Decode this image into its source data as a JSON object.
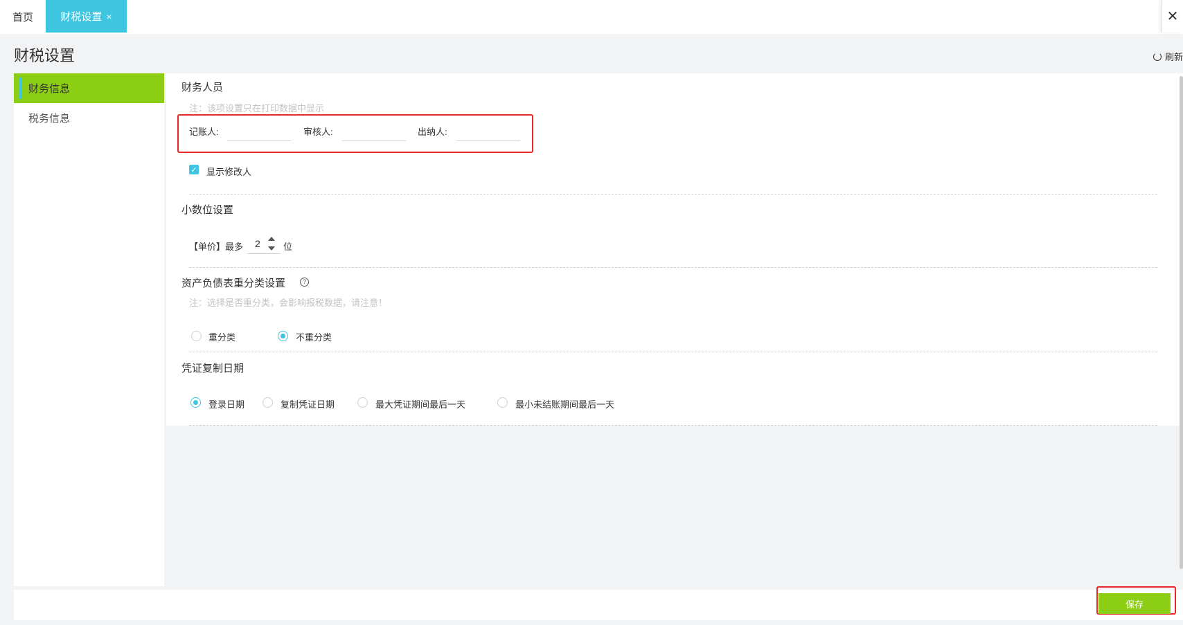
{
  "tabs": {
    "home": "首页",
    "active": "财税设置",
    "active_close": "×",
    "window_close": "✕"
  },
  "page": {
    "title": "财税设置",
    "refresh": "刷新"
  },
  "sidebar": {
    "items": [
      {
        "label": "财务信息",
        "active": true
      },
      {
        "label": "税务信息",
        "active": false
      }
    ]
  },
  "finance_staff": {
    "title": "财务人员",
    "note": "注：该项设置只在打印数据中显示",
    "bookkeeper_label": "记账人:",
    "bookkeeper_value": "",
    "reviewer_label": "审核人:",
    "reviewer_value": "",
    "cashier_label": "出纳人:",
    "cashier_value": "",
    "show_modifier_label": "显示修改人",
    "show_modifier_checked": true
  },
  "decimal": {
    "title": "小数位设置",
    "prefix": "【单价】最多",
    "value": "2",
    "suffix": "位"
  },
  "reclass": {
    "title": "资产负债表重分类设置",
    "note": "注：选择是否重分类，会影响报税数据，请注意！",
    "options": [
      {
        "label": "重分类",
        "checked": false
      },
      {
        "label": "不重分类",
        "checked": true
      }
    ]
  },
  "voucher_copy_date": {
    "title": "凭证复制日期",
    "options": [
      {
        "label": "登录日期",
        "checked": true
      },
      {
        "label": "复制凭证日期",
        "checked": false
      },
      {
        "label": "最大凭证期间最后一天",
        "checked": false
      },
      {
        "label": "最小未结账期间最后一天",
        "checked": false
      }
    ]
  },
  "footer": {
    "save_label": "保存"
  },
  "colors": {
    "accent_cyan": "#3ec5df",
    "accent_green": "#8cce13",
    "highlight_red": "#e8292a"
  }
}
